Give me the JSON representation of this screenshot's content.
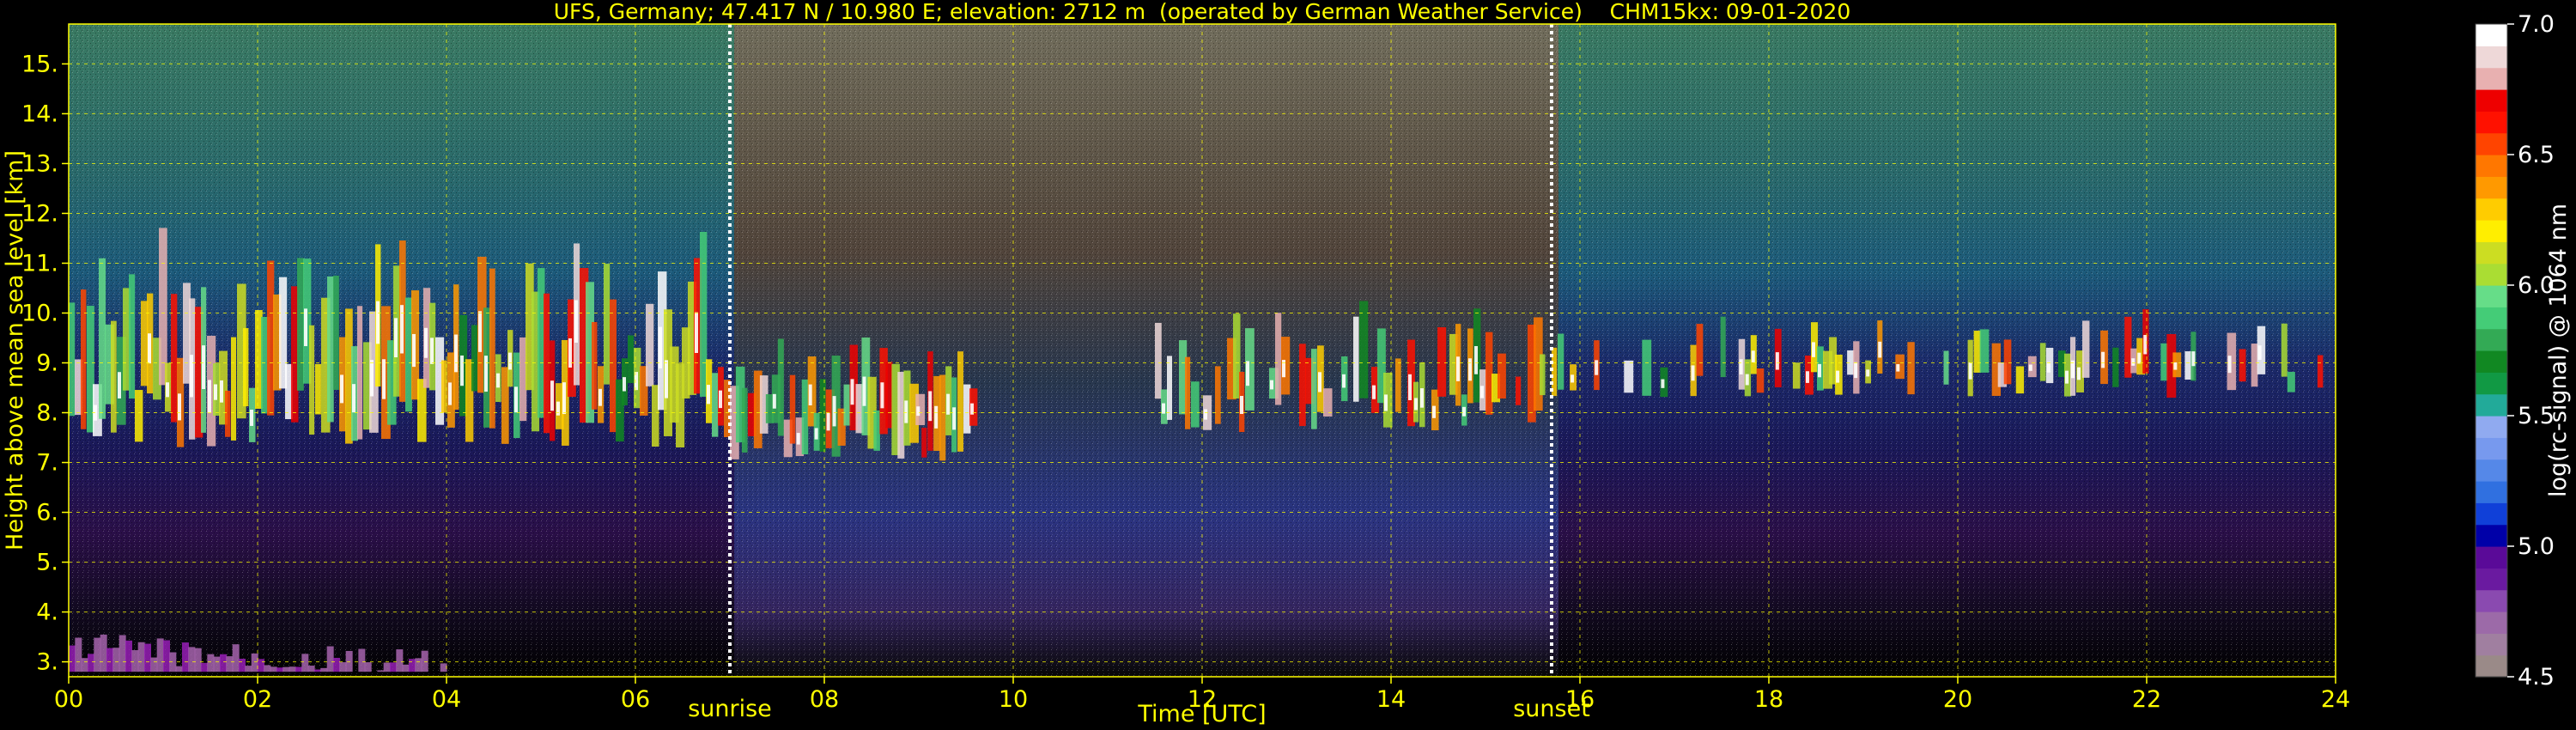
{
  "chart_data": {
    "type": "heatmap",
    "title": "UFS, Germany; 47.417 N / 10.980 E; elevation: 2712 m  (operated by German Weather Service)    CHM15kx: 09-01-2020",
    "xlabel": "Time [UTC]",
    "ylabel": "Height above mean sea level [km]",
    "xlim": [
      0,
      24
    ],
    "ylim": [
      2.7,
      15.8
    ],
    "x_ticks": [
      0,
      2,
      4,
      6,
      8,
      10,
      12,
      14,
      16,
      18,
      20,
      22,
      24
    ],
    "x_tick_labels": [
      "00",
      "02",
      "04",
      "06",
      "08",
      "10",
      "12",
      "14",
      "16",
      "18",
      "20",
      "22",
      "24"
    ],
    "y_ticks": [
      3,
      4,
      5,
      6,
      7,
      8,
      9,
      10,
      11,
      12,
      13,
      14,
      15
    ],
    "y_tick_labels": [
      "3.",
      "4.",
      "5.",
      "6.",
      "7.",
      "8.",
      "9.",
      "10.",
      "11.",
      "12.",
      "13.",
      "14.",
      "15."
    ],
    "grid": true,
    "markers": [
      {
        "label": "sunrise",
        "time_utc": 7.0
      },
      {
        "label": "sunset",
        "time_utc": 15.7
      }
    ],
    "colorbar": {
      "label": "log(rc-signal) @ 1064 nm",
      "min": 4.5,
      "max": 7.0,
      "ticks": [
        4.5,
        5.0,
        5.5,
        6.0,
        6.5,
        7.0
      ],
      "tick_labels": [
        "4.5",
        "5.0",
        "5.5",
        "6.0",
        "6.5",
        "7.0"
      ],
      "colors": [
        "#9a8a88",
        "#a07fa0",
        "#9c6aa8",
        "#8a4ab0",
        "#6a1aa0",
        "#5a0a98",
        "#0000a8",
        "#1040d8",
        "#3070e0",
        "#5588e8",
        "#7799ee",
        "#90aaf0",
        "#22aa99",
        "#119944",
        "#118822",
        "#33aa55",
        "#44cc77",
        "#66dd88",
        "#aadd33",
        "#ccdd22",
        "#ffee00",
        "#ffcc00",
        "#ff9900",
        "#ff7700",
        "#ff4400",
        "#ff1100",
        "#ee0000",
        "#e8b0b0",
        "#eed8d8",
        "#ffffff"
      ]
    },
    "cloud_layer": [
      {
        "start_utc": 0.0,
        "end_utc": 7.0,
        "base_km": 7.3,
        "top_km": 11.0,
        "max_log_signal": 7.0
      },
      {
        "start_utc": 7.0,
        "end_utc": 9.6,
        "base_km": 7.0,
        "top_km": 9.3,
        "max_log_signal": 7.0
      },
      {
        "start_utc": 11.5,
        "end_utc": 15.7,
        "base_km": 7.6,
        "top_km": 9.8,
        "max_log_signal": 7.0
      },
      {
        "start_utc": 15.7,
        "end_utc": 24.0,
        "base_km": 8.3,
        "top_km": 9.8,
        "max_log_signal": 7.0
      }
    ],
    "surface_layer": {
      "start_utc": 0.0,
      "end_utc": 4.0,
      "base_km": 2.8,
      "top_km": 3.6
    }
  }
}
